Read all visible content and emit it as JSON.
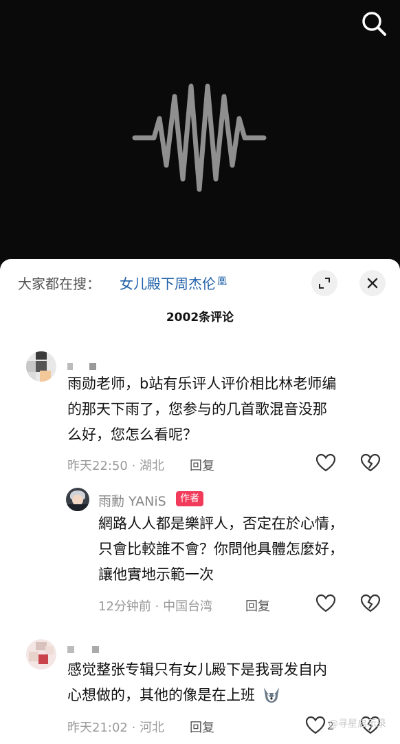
{
  "header": {
    "search_icon": "search-icon",
    "waveform_icon": "audio-waveform-icon"
  },
  "sheet": {
    "hot_search_label": "大家都在搜：",
    "hot_search_query": "女儿殿下周杰伦",
    "comment_count": "2002条评论",
    "expand_icon": "expand-icon",
    "close_icon": "close-icon"
  },
  "comments": [
    {
      "text_lines": [
        "雨勋老师，b站有乐评人评价相比林老师编",
        "的那天下雨了，您参与的几首歌混音没那",
        "么好，您怎么看呢？"
      ],
      "time": "昨天22:50",
      "location": "湖北",
      "reply_label": "回复"
    },
    {
      "author": "雨勳 YANiS",
      "badge": "作者",
      "text_lines": [
        "網路人人都是樂評人，否定在於心情，",
        "只會比較誰不會？你問他具體怎麼好，",
        "讓他實地示範一次"
      ],
      "time": "12分钟前",
      "location": "中国台湾",
      "reply_label": "回复"
    },
    {
      "text_lines": [
        "感觉整张专辑只有女儿殿下是我哥发自内",
        "心想做的，其他的像是在上班"
      ],
      "time": "昨天21:02",
      "location": "河北",
      "reply_label": "回复",
      "like_count": "2"
    }
  ],
  "watermark": "@寻星启示录",
  "colors": {
    "link_blue": "#1e5fa8",
    "author_badge": "#f23a5a"
  }
}
